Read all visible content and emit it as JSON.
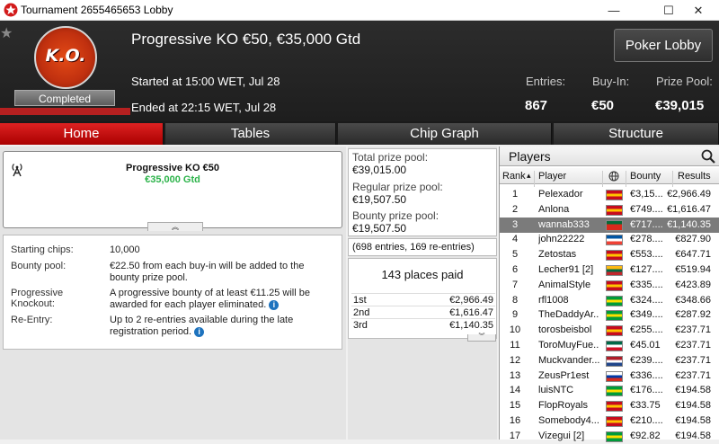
{
  "window": {
    "title": "Tournament 2655465653 Lobby",
    "controls": {
      "minimize": "—",
      "maximize": "☐",
      "close": "✕"
    }
  },
  "header": {
    "badge_text": "K.O.",
    "status": "Completed",
    "tournament_name": "Progressive KO €50, €35,000 Gtd",
    "started": "Started at 15:00 WET, Jul 28",
    "ended": "Ended at 22:15 WET, Jul 28",
    "poker_lobby_label": "Poker Lobby",
    "stats": [
      {
        "label": "Entries:",
        "value": "867"
      },
      {
        "label": "Buy-In:",
        "value": "€50"
      },
      {
        "label": "Prize Pool:",
        "value": "€39,015"
      }
    ]
  },
  "tabs": [
    "Home",
    "Tables",
    "Chip Graph",
    "Structure"
  ],
  "active_tab": "Home",
  "info": {
    "title": "Progressive KO €50",
    "subtitle": "€35,000 Gtd"
  },
  "details": {
    "starting_chips_label": "Starting chips:",
    "starting_chips": "10,000",
    "bounty_pool_label": "Bounty pool:",
    "bounty_pool": "€22.50 from each buy-in will be added to the bounty prize pool.",
    "pko_label": "Progressive Knockout:",
    "pko": "A progressive bounty of at least €11.25 will be awarded for each player eliminated.",
    "reentry_label": "Re-Entry:",
    "reentry": "Up to 2 re-entries available during the late registration period."
  },
  "prizes": {
    "total_label": "Total prize pool:",
    "total": "€39,015.00",
    "regular_label": "Regular prize pool:",
    "regular": "€19,507.50",
    "bounty_label": "Bounty prize pool:",
    "bounty": "€19,507.50",
    "entries_line": "(698 entries, 169 re-entries)",
    "places_paid": "143 places paid",
    "payouts": [
      {
        "place": "1st",
        "amount": "€2,966.49"
      },
      {
        "place": "2nd",
        "amount": "€1,616.47"
      },
      {
        "place": "3rd",
        "amount": "€1,140.35"
      }
    ]
  },
  "players": {
    "title": "Players",
    "columns": {
      "rank": "Rank",
      "player": "Player",
      "bounty": "Bounty",
      "results": "Results"
    },
    "rows": [
      {
        "rank": "1",
        "name": "Pelexador",
        "flag": [
          "#c60b1e",
          "#ffc400",
          "#c60b1e"
        ],
        "bounty": "€3,15...",
        "result": "€2,966.49"
      },
      {
        "rank": "2",
        "name": "Anlona",
        "flag": [
          "#c60b1e",
          "#ffc400",
          "#c60b1e"
        ],
        "bounty": "€749....",
        "result": "€1,616.47"
      },
      {
        "rank": "3",
        "name": "wannab333",
        "flag": [
          "#046a38",
          "#da291c",
          "#da291c"
        ],
        "bounty": "€717....",
        "result": "€1,140.35"
      },
      {
        "rank": "4",
        "name": "john22222",
        "flag": [
          "#0055a4",
          "#ffffff",
          "#ef4135"
        ],
        "bounty": "€278....",
        "result": "€827.90"
      },
      {
        "rank": "5",
        "name": "Zetostas",
        "flag": [
          "#c60b1e",
          "#ffc400",
          "#c60b1e"
        ],
        "bounty": "€553....",
        "result": "€647.71"
      },
      {
        "rank": "6",
        "name": "Lecher91 [2]",
        "flag": [
          "#fdb913",
          "#006a44",
          "#c1272d"
        ],
        "bounty": "€127....",
        "result": "€519.94"
      },
      {
        "rank": "7",
        "name": "AnimalStyle",
        "flag": [
          "#c60b1e",
          "#ffc400",
          "#c60b1e"
        ],
        "bounty": "€335....",
        "result": "€423.89"
      },
      {
        "rank": "8",
        "name": "rfl1008",
        "flag": [
          "#009b3a",
          "#fedf00",
          "#009b3a"
        ],
        "bounty": "€324....",
        "result": "€348.66"
      },
      {
        "rank": "9",
        "name": "TheDaddyAr...",
        "flag": [
          "#009b3a",
          "#fedf00",
          "#009b3a"
        ],
        "bounty": "€349....",
        "result": "€287.92"
      },
      {
        "rank": "10",
        "name": "torosbeisbol",
        "flag": [
          "#c60b1e",
          "#ffc400",
          "#c60b1e"
        ],
        "bounty": "€255....",
        "result": "€237.71"
      },
      {
        "rank": "11",
        "name": "ToroMuyFue...",
        "flag": [
          "#006847",
          "#ffffff",
          "#ce1126"
        ],
        "bounty": "€45.01",
        "result": "€237.71"
      },
      {
        "rank": "12",
        "name": "Muckvander...",
        "flag": [
          "#ae1c28",
          "#ffffff",
          "#21468b"
        ],
        "bounty": "€239....",
        "result": "€237.71"
      },
      {
        "rank": "13",
        "name": "ZeusPr1est",
        "flag": [
          "#ffffff",
          "#0039a6",
          "#d52b1e"
        ],
        "bounty": "€336....",
        "result": "€237.71"
      },
      {
        "rank": "14",
        "name": "luisNTC",
        "flag": [
          "#009b3a",
          "#fedf00",
          "#009b3a"
        ],
        "bounty": "€176....",
        "result": "€194.58"
      },
      {
        "rank": "15",
        "name": "FlopRoyals",
        "flag": [
          "#c60b1e",
          "#ffc400",
          "#c60b1e"
        ],
        "bounty": "€33.75",
        "result": "€194.58"
      },
      {
        "rank": "16",
        "name": "Somebody4...",
        "flag": [
          "#c60b1e",
          "#ffc400",
          "#c60b1e"
        ],
        "bounty": "€210....",
        "result": "€194.58"
      },
      {
        "rank": "17",
        "name": "Vizegui [2]",
        "flag": [
          "#009b3a",
          "#fedf00",
          "#009b3a"
        ],
        "bounty": "€92.82",
        "result": "€194.58"
      }
    ],
    "selected_rank": "3"
  },
  "colors": {
    "accent_red": "#cc1a1a",
    "gtd_green": "#2cb34a",
    "header_dark": "#222222",
    "selected_row": "#7b7b7b"
  }
}
